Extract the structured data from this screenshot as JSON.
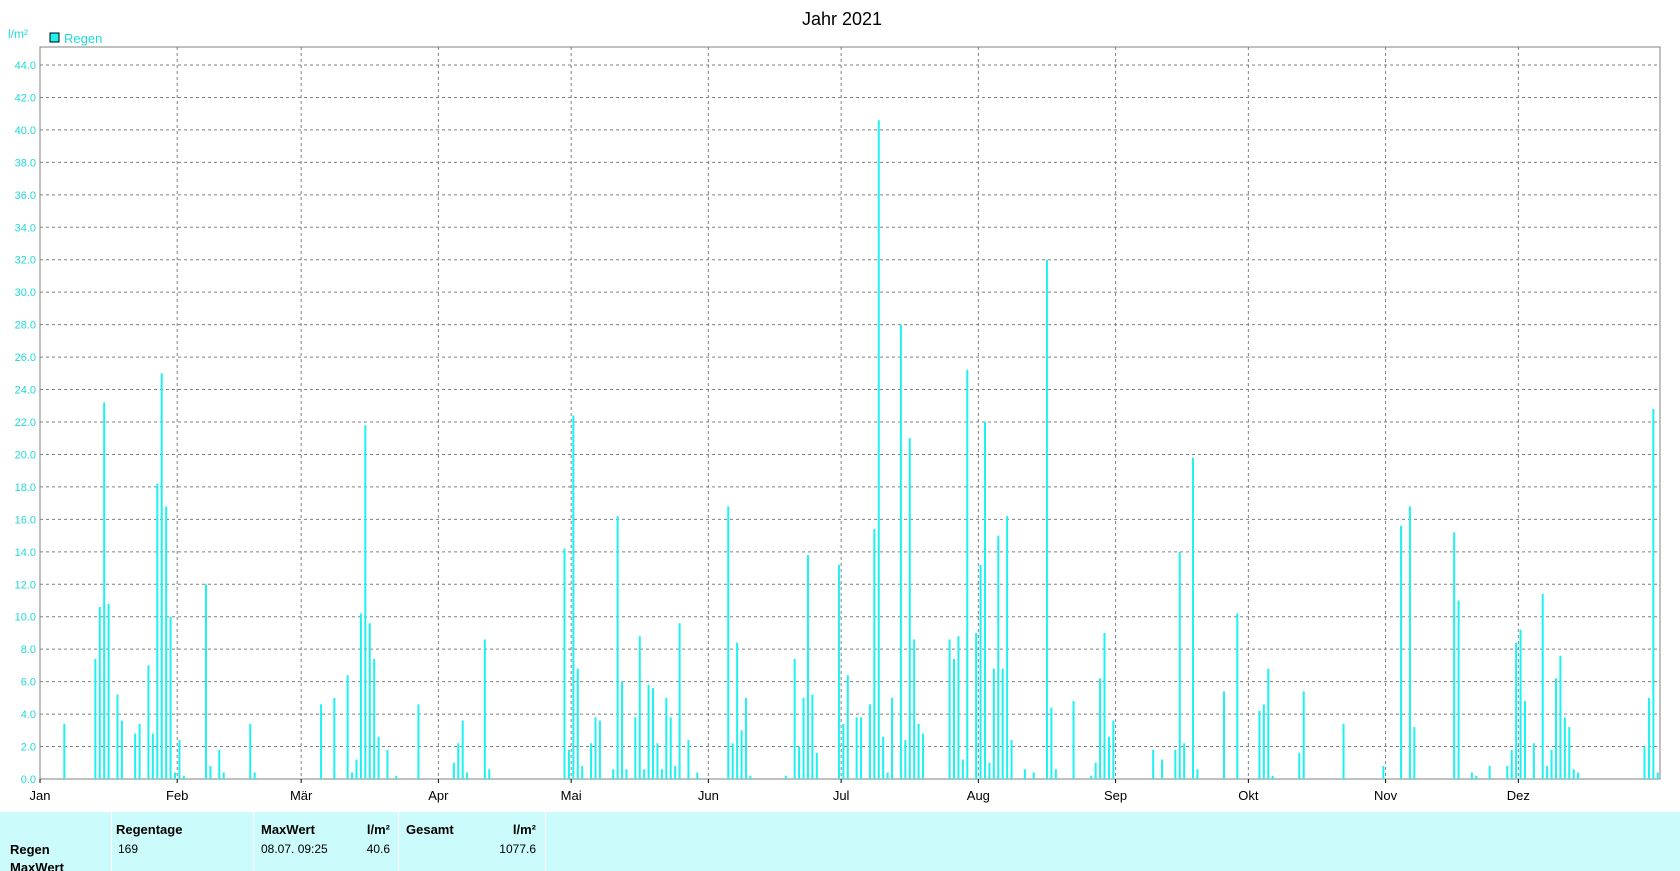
{
  "colors": {
    "series": "#1ff0f0",
    "axis_text": "#21d9d9",
    "grid": "#808080",
    "summary_bg": "#ccfbfb"
  },
  "chart_data": {
    "type": "bar",
    "title": "Jahr 2021",
    "ylabel": "l/m²",
    "ylim": [
      0,
      44
    ],
    "yticks": [
      "0.0",
      "2.0",
      "4.0",
      "6.0",
      "8.0",
      "10.0",
      "12.0",
      "14.0",
      "16.0",
      "18.0",
      "20.0",
      "22.0",
      "24.0",
      "26.0",
      "28.0",
      "30.0",
      "32.0",
      "34.0",
      "36.0",
      "38.0",
      "40.0",
      "42.0",
      "44.0"
    ],
    "months": [
      "Jan",
      "Feb",
      "Mär",
      "Apr",
      "Mai",
      "Jun",
      "Jul",
      "Aug",
      "Sep",
      "Okt",
      "Nov",
      "Dez"
    ],
    "legend": {
      "position": "top-left"
    },
    "grid": true,
    "series": [
      {
        "name": "Regen",
        "x_unit": "day of year",
        "points": [
          [
            6,
            3.4
          ],
          [
            13,
            7.4
          ],
          [
            14,
            10.6
          ],
          [
            15,
            23.2
          ],
          [
            16,
            10.8
          ],
          [
            18,
            5.2
          ],
          [
            19,
            3.6
          ],
          [
            22,
            2.8
          ],
          [
            23,
            3.4
          ],
          [
            25,
            7
          ],
          [
            26,
            2.8
          ],
          [
            27,
            18.2
          ],
          [
            28,
            25
          ],
          [
            29,
            16.8
          ],
          [
            30,
            10
          ],
          [
            31,
            0.4
          ],
          [
            32,
            2.4
          ],
          [
            33,
            0.2
          ],
          [
            38,
            12
          ],
          [
            39,
            0.8
          ],
          [
            41,
            1.8
          ],
          [
            42,
            0.4
          ],
          [
            48,
            3.4
          ],
          [
            49,
            0.4
          ],
          [
            64,
            4.6
          ],
          [
            67,
            5
          ],
          [
            70,
            6.4
          ],
          [
            71,
            0.4
          ],
          [
            72,
            1.2
          ],
          [
            73,
            10.2
          ],
          [
            74,
            21.8
          ],
          [
            75,
            9.6
          ],
          [
            76,
            7.4
          ],
          [
            77,
            2.6
          ],
          [
            79,
            1.8
          ],
          [
            81,
            0.2
          ],
          [
            86,
            4.6
          ],
          [
            94,
            1
          ],
          [
            95,
            2.2
          ],
          [
            96,
            3.6
          ],
          [
            97,
            0.4
          ],
          [
            101,
            8.6
          ],
          [
            102,
            0.6
          ],
          [
            119,
            14.2
          ],
          [
            120,
            1.8
          ],
          [
            121,
            22.4
          ],
          [
            122,
            6.8
          ],
          [
            123,
            0.8
          ],
          [
            125,
            2.2
          ],
          [
            126,
            3.8
          ],
          [
            127,
            3.6
          ],
          [
            130,
            0.6
          ],
          [
            131,
            16.2
          ],
          [
            132,
            6
          ],
          [
            133,
            0.6
          ],
          [
            135,
            3.8
          ],
          [
            136,
            8.8
          ],
          [
            137,
            0.6
          ],
          [
            138,
            5.8
          ],
          [
            139,
            5.6
          ],
          [
            140,
            2.2
          ],
          [
            141,
            0.6
          ],
          [
            142,
            5
          ],
          [
            143,
            3.8
          ],
          [
            144,
            0.8
          ],
          [
            145,
            9.6
          ],
          [
            147,
            2.4
          ],
          [
            149,
            0.4
          ],
          [
            156,
            16.8
          ],
          [
            157,
            2.2
          ],
          [
            158,
            8.4
          ],
          [
            159,
            3
          ],
          [
            160,
            5
          ],
          [
            161,
            0.2
          ],
          [
            169,
            0.2
          ],
          [
            171,
            7.4
          ],
          [
            172,
            2
          ],
          [
            173,
            5
          ],
          [
            174,
            13.8
          ],
          [
            175,
            5.2
          ],
          [
            176,
            1.6
          ],
          [
            181,
            13.2
          ],
          [
            182,
            3.4
          ],
          [
            183,
            6.4
          ],
          [
            185,
            3.8
          ],
          [
            186,
            3.8
          ],
          [
            188,
            4.6
          ],
          [
            189,
            15.4
          ],
          [
            190,
            40.6
          ],
          [
            191,
            2.6
          ],
          [
            192,
            0.4
          ],
          [
            193,
            5
          ],
          [
            195,
            28
          ],
          [
            196,
            2.4
          ],
          [
            197,
            21
          ],
          [
            198,
            8.6
          ],
          [
            199,
            3.4
          ],
          [
            200,
            2.8
          ],
          [
            206,
            8.6
          ],
          [
            207,
            7.4
          ],
          [
            208,
            8.8
          ],
          [
            209,
            1.2
          ],
          [
            210,
            25.2
          ],
          [
            212,
            9
          ],
          [
            213,
            13.2
          ],
          [
            214,
            22
          ],
          [
            215,
            1
          ],
          [
            216,
            6.8
          ],
          [
            217,
            15
          ],
          [
            218,
            6.8
          ],
          [
            219,
            16.2
          ],
          [
            220,
            2.4
          ],
          [
            223,
            0.6
          ],
          [
            225,
            0.4
          ],
          [
            228,
            32
          ],
          [
            229,
            4.4
          ],
          [
            230,
            0.6
          ],
          [
            234,
            4.8
          ],
          [
            238,
            0.2
          ],
          [
            239,
            1
          ],
          [
            240,
            6.2
          ],
          [
            241,
            9
          ],
          [
            242,
            2.6
          ],
          [
            243,
            3.6
          ],
          [
            252,
            1.8
          ],
          [
            254,
            1.2
          ],
          [
            257,
            1.8
          ],
          [
            258,
            14
          ],
          [
            259,
            2.2
          ],
          [
            261,
            19.8
          ],
          [
            262,
            0.6
          ],
          [
            268,
            5.4
          ],
          [
            271,
            10.2
          ],
          [
            276,
            4.2
          ],
          [
            277,
            4.6
          ],
          [
            278,
            6.8
          ],
          [
            279,
            0.2
          ],
          [
            285,
            1.6
          ],
          [
            286,
            5.4
          ],
          [
            295,
            3.4
          ],
          [
            304,
            0.8
          ],
          [
            308,
            15.6
          ],
          [
            310,
            16.8
          ],
          [
            311,
            3.2
          ],
          [
            320,
            15.2
          ],
          [
            321,
            11
          ],
          [
            324,
            0.4
          ],
          [
            325,
            0.2
          ],
          [
            328,
            0.8
          ],
          [
            332,
            0.8
          ],
          [
            333,
            1.8
          ],
          [
            334,
            8.4
          ],
          [
            335,
            9.2
          ],
          [
            336,
            4.8
          ],
          [
            338,
            2.2
          ],
          [
            340,
            11.4
          ],
          [
            341,
            0.8
          ],
          [
            342,
            1.8
          ],
          [
            343,
            6.2
          ],
          [
            344,
            7.6
          ],
          [
            345,
            3.8
          ],
          [
            346,
            3.2
          ],
          [
            347,
            0.6
          ],
          [
            348,
            0.4
          ],
          [
            363,
            2
          ],
          [
            364,
            5
          ],
          [
            365,
            22.8
          ],
          [
            366,
            0.4
          ]
        ]
      }
    ]
  },
  "summary": {
    "row_labels": [
      "Regen",
      "MaxWert"
    ],
    "regentage": {
      "header": "Regentage",
      "value": "169"
    },
    "maxwert": {
      "header": "MaxWert",
      "unit": "l/m²",
      "date": "08.07.  09:25",
      "value": "40.6"
    },
    "gesamt": {
      "header": "Gesamt",
      "unit": "l/m²",
      "value": "1077.6"
    }
  }
}
